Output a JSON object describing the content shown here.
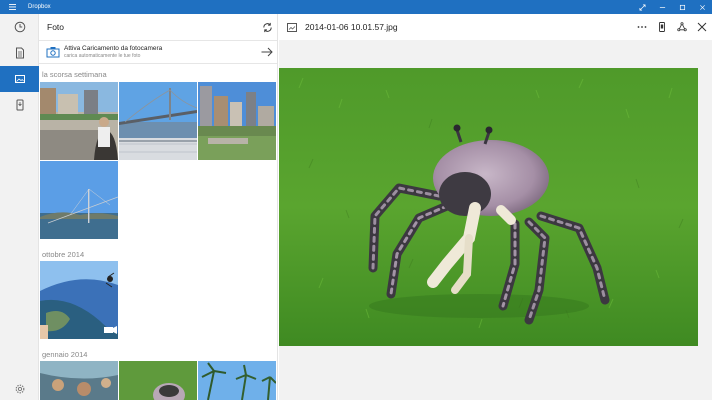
{
  "app": {
    "title": "Dropbox"
  },
  "nav": {
    "items": [
      {
        "icon": "recent-icon"
      },
      {
        "icon": "files-icon"
      },
      {
        "icon": "photos-icon",
        "active": true
      },
      {
        "icon": "offline-icon"
      }
    ],
    "settings_icon": "gear-icon"
  },
  "photos": {
    "title": "Foto",
    "upload_banner": {
      "title": "Attiva Caricamento da fotocamera",
      "subtitle": "carica automaticamente le tue foto"
    },
    "sections": [
      {
        "label": "la scorsa settimana"
      },
      {
        "label": "ottobre 2014"
      },
      {
        "label": "gennaio 2014"
      }
    ]
  },
  "viewer": {
    "file_name": "2014-01-06 10.01.57.jpg"
  },
  "colors": {
    "accent": "#1f70c1",
    "rail_bg": "#f2f2f2"
  }
}
